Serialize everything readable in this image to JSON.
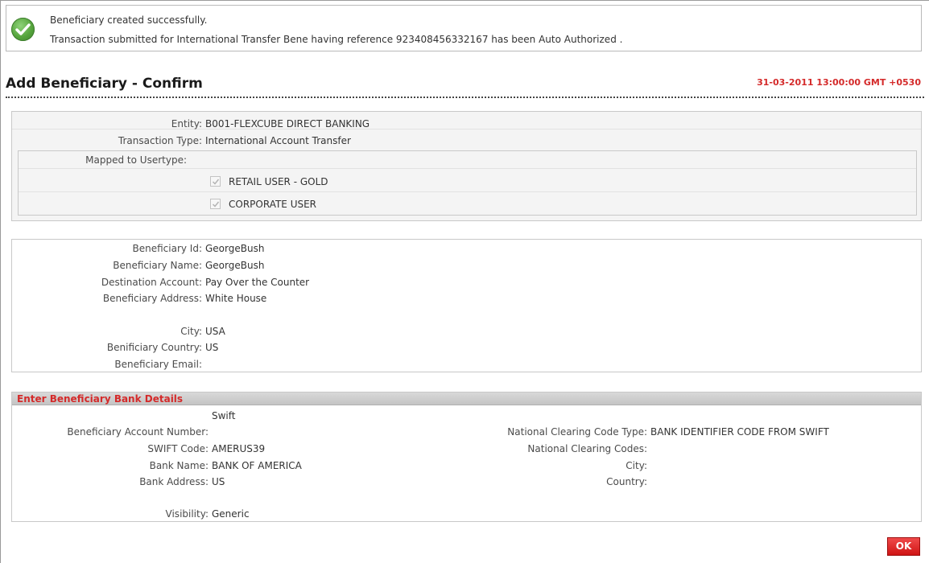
{
  "messages": {
    "line1": "Beneficiary created successfully.",
    "line2": "Transaction submitted for International Transfer Bene having reference 923408456332167 has been Auto Authorized ."
  },
  "header": {
    "title": "Add Beneficiary - Confirm",
    "datetime": "31-03-2011 13:00:00 GMT +0530"
  },
  "entity_panel": {
    "entity_label": "Entity:",
    "entity_value": "B001-FLEXCUBE DIRECT BANKING",
    "txn_type_label": "Transaction Type:",
    "txn_type_value": "International Account Transfer",
    "mapped_label": "Mapped to Usertype:",
    "usertypes": [
      {
        "label": "RETAIL USER - GOLD",
        "checked": true
      },
      {
        "label": "CORPORATE USER",
        "checked": true
      }
    ]
  },
  "beneficiary": {
    "id_label": "Beneficiary Id:",
    "id_value": "GeorgeBush",
    "name_label": "Beneficiary Name:",
    "name_value": "GeorgeBush",
    "dest_label": "Destination Account:",
    "dest_value": "Pay Over the Counter",
    "address_label": "Beneficiary Address:",
    "address_value": "White House",
    "city_label": "City:",
    "city_value": "USA",
    "country_label": "Benificiary Country:",
    "country_value": "US",
    "email_label": "Beneficiary Email:",
    "email_value": ""
  },
  "bank_details": {
    "heading": "Enter Beneficiary Bank Details",
    "network_value": "Swift",
    "account_label": "Beneficiary Account Number:",
    "account_value": "",
    "swift_label": "SWIFT Code:",
    "swift_value": "AMERUS39",
    "bank_name_label": "Bank Name:",
    "bank_name_value": "BANK OF AMERICA",
    "bank_address_label": "Bank Address:",
    "bank_address_value": "US",
    "visibility_label": "Visibility:",
    "visibility_value": "Generic",
    "ncc_type_label": "National Clearing Code Type:",
    "ncc_type_value": "BANK IDENTIFIER CODE FROM SWIFT",
    "ncc_codes_label": "National Clearing Codes:",
    "ncc_codes_value": "",
    "city_label": "City:",
    "city_value": "",
    "country_label": "Country:",
    "country_value": ""
  },
  "actions": {
    "ok_label": "OK"
  },
  "colors": {
    "accent_red": "#d42a2a",
    "success_green": "#55a43c"
  },
  "icons": {
    "success": "check-circle-icon",
    "checkbox": "checkmark-icon"
  }
}
